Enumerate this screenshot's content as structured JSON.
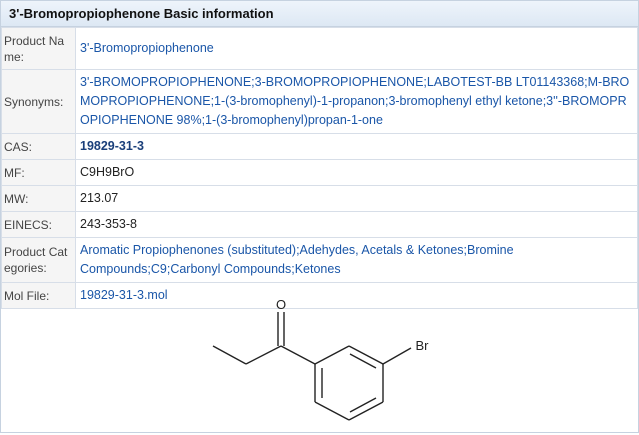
{
  "header": {
    "title": "3'-Bromopropiophenone Basic information"
  },
  "rows": {
    "product_name": {
      "label": "Product Na me:",
      "value": "3'-Bromopropiophenone"
    },
    "synonyms": {
      "label": "Synonyms:",
      "value": "3'-BROMOPROPIOPHENONE;3-BROMOPROPIOPHENONE;LABOTEST-BB LT01143368;M-BROMOPROPIOPHENONE;1-(3-bromophenyl)-1-propanon;3-bromophenyl ethyl ketone;3''-BROMOPROPIOPHENONE 98%;1-(3-bromophenyl)propan-1-one"
    },
    "cas": {
      "label": "CAS:",
      "value": "19829-31-3"
    },
    "mf": {
      "label": "MF:",
      "value": "C9H9BrO"
    },
    "mw": {
      "label": "MW:",
      "value": "213.07"
    },
    "einecs": {
      "label": "EINECS:",
      "value": "243-353-8"
    },
    "categories": {
      "label": "Product Cat egories:",
      "value": "Aromatic Propiophenones (substituted);Adehydes, Acetals & Ketones;Bromine Compounds;C9;Carbonyl Compounds;Ketones"
    },
    "mol_file": {
      "label": "Mol File:",
      "value": "19829-31-3.mol"
    }
  },
  "structure": {
    "atom_o": "O",
    "atom_br": "Br"
  },
  "colors": {
    "link": "#1a56a8",
    "header_bg": "#dde8f4",
    "border": "#d7dee8"
  }
}
